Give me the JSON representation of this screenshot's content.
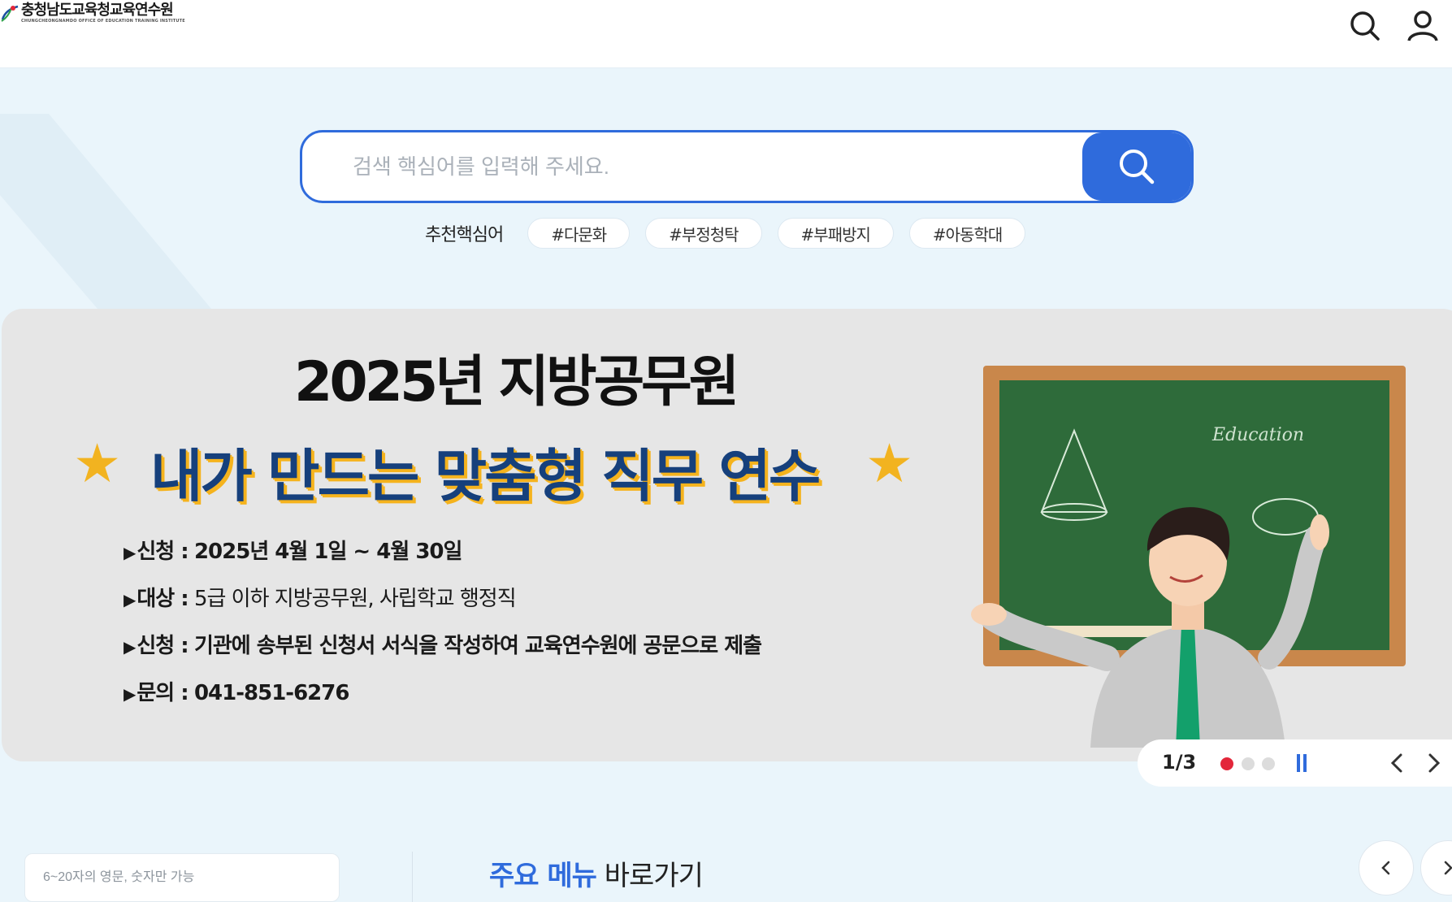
{
  "header": {
    "logo_name": "충청남도교육청교육연수원",
    "logo_sub": "CHUNGCHEONGNAMDO OFFICE OF EDUCATION TRAINING INSTITUTE"
  },
  "search": {
    "placeholder": "검색 핵심어를 입력해 주세요.",
    "recommend_label": "추천핵심어",
    "keywords": [
      "#다문화",
      "#부정청탁",
      "#부패방지",
      "#아동학대"
    ]
  },
  "banner": {
    "title": "2025년 지방공무원",
    "subtitle": "내가 만드는 맞춤형 직무 연수",
    "star": "★",
    "items": [
      {
        "key": "신청 :",
        "value": "2025년 4월 1일 ~ 4월 30일"
      },
      {
        "key": "대상 :",
        "value": "5급 이하 지방공무원, 사립학교 행정직"
      },
      {
        "key": "신청 :",
        "value": "기관에 송부된 신청서 서식을 작성하여 교육연수원에 공문으로 제출"
      },
      {
        "key": "문의 :",
        "value": "041-851-6276"
      }
    ],
    "board_text": "Education"
  },
  "slider": {
    "counter": "1/3",
    "current": 1,
    "total": 3
  },
  "login": {
    "placeholder": "6~20자의 영문, 숫자만 가능"
  },
  "main_menu": {
    "highlight": "주요 메뉴",
    "rest": "바로가기"
  },
  "colors": {
    "accent": "#2f6bdc",
    "background": "#eaf5fb",
    "banner_bg": "#e6e6e6",
    "active_dot": "#e3263a",
    "star": "#f2b320",
    "subtitle": "#16407c"
  }
}
